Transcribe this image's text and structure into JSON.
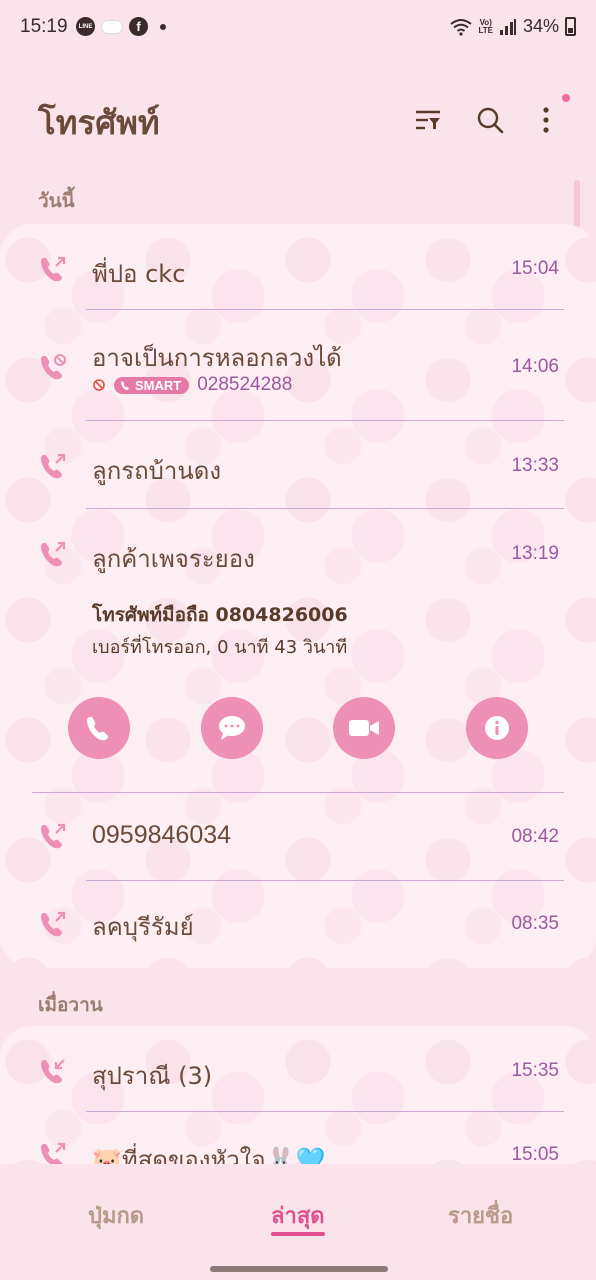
{
  "status_bar": {
    "time": "15:19",
    "line_icon_text": "LINE",
    "battery": "34%",
    "network": "LTE"
  },
  "app": {
    "title": "โทรศัพท์"
  },
  "sections": {
    "today": "วันนี้",
    "yesterday": "เมื่อวาน"
  },
  "calls_today": [
    {
      "name": "พี่ปอ ckc",
      "time": "15:04",
      "type": "outgoing"
    },
    {
      "name": "อาจเป็นการหลอกลวงได้",
      "time": "14:06",
      "type": "blocked"
    },
    {
      "name": "ลูกรถบ้านดง",
      "time": "13:33",
      "type": "outgoing"
    },
    {
      "name": "ลูกค้าเพจระยอง",
      "time": "13:19",
      "type": "outgoing"
    },
    {
      "name": "0959846034",
      "time": "08:42",
      "type": "outgoing"
    },
    {
      "name": "ลคบุรีรัมย์",
      "time": "08:35",
      "type": "outgoing"
    }
  ],
  "spam_detail": {
    "badge": "SMART",
    "number": "028524288"
  },
  "expanded": {
    "phone_line": "โทรศัพท์มือถือ 0804826006",
    "info_line": "เบอร์ที่โทรออก, 0 นาที 43 วินาที"
  },
  "calls_yesterday": [
    {
      "name": "สุปราณี (3)",
      "time": "15:35",
      "type": "incoming"
    },
    {
      "name": "🐷ที่สุดของหัวใจ🐰🩵",
      "time": "15:05",
      "type": "outgoing"
    }
  ],
  "bottom_nav": {
    "keypad": "ปุ่มกด",
    "recents": "ล่าสุด",
    "contacts": "รายชื่อ"
  },
  "colors": {
    "accent": "#e0508f",
    "icon_pink": "#ee8fb6",
    "time_purple": "#9a5aa0"
  }
}
